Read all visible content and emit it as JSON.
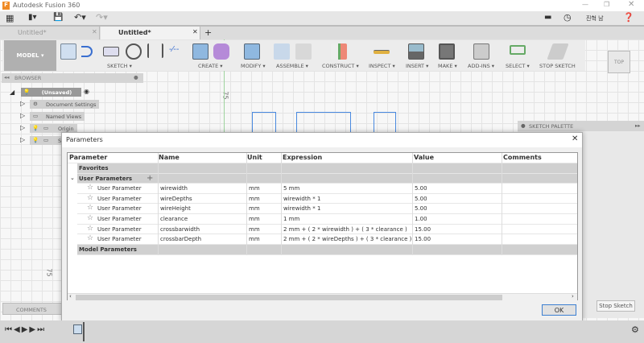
{
  "app": {
    "title": "Autodesk Fusion 360",
    "user": "진혁 남"
  },
  "tabs": [
    {
      "label": "Untitled*"
    },
    {
      "label": "Untitled*"
    }
  ],
  "toolbar": {
    "workspace": "MODEL",
    "groups": [
      "SKETCH",
      "CREATE",
      "MODIFY",
      "ASSEMBLE",
      "CONSTRUCT",
      "INSPECT",
      "INSERT",
      "MAKE",
      "ADD-INS",
      "SELECT",
      "STOP SKETCH"
    ]
  },
  "viewcube": {
    "label": "TOP"
  },
  "browser": {
    "title": "BROWSER",
    "root": "(Unsaved)",
    "items": [
      "Document Settings",
      "Named Views",
      "Origin",
      "S"
    ]
  },
  "canvas": {
    "dim1": "75",
    "dim2": "75"
  },
  "sketch_palette": {
    "title": "SKETCH PALETTE",
    "stop": "Stop Sketch"
  },
  "comments": "COMMENTS",
  "dialog": {
    "title": "Parameters",
    "columns": [
      "Parameter",
      "Name",
      "Unit",
      "Expression",
      "Value",
      "Comments"
    ],
    "sections": {
      "favorites": "Favorites",
      "user": "User Parameters",
      "model": "Model Parameters"
    },
    "rows": [
      {
        "type": "User Parameter",
        "name": "wirewidth",
        "unit": "mm",
        "expr": "5 mm",
        "value": "5.00",
        "comment": ""
      },
      {
        "type": "User Parameter",
        "name": "wireDepths",
        "unit": "mm",
        "expr": "wirewidth * 1",
        "value": "5.00",
        "comment": ""
      },
      {
        "type": "User Parameter",
        "name": "wireHeight",
        "unit": "mm",
        "expr": "wirewidth * 1",
        "value": "5.00",
        "comment": ""
      },
      {
        "type": "User Parameter",
        "name": "clearance",
        "unit": "mm",
        "expr": "1 mm",
        "value": "1.00",
        "comment": ""
      },
      {
        "type": "User Parameter",
        "name": "crossbarwidth",
        "unit": "mm",
        "expr": "2 mm + ( 2 * wirewidth ) + ( 3 * clearance )",
        "value": "15.00",
        "comment": ""
      },
      {
        "type": "User Parameter",
        "name": "crossbarDepth",
        "unit": "mm",
        "expr": "2 mm + ( 2 * wireDepths ) + ( 3 * clearance )",
        "value": "15.00",
        "comment": ""
      }
    ],
    "ok": "OK"
  }
}
